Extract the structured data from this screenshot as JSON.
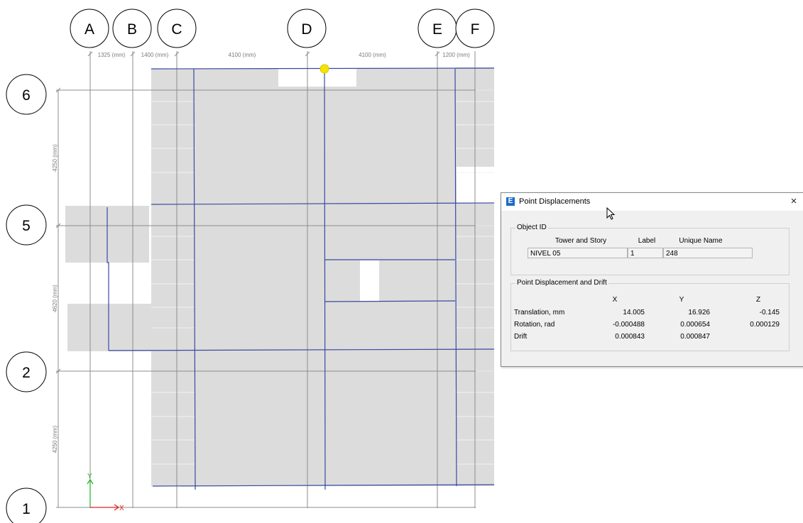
{
  "grid": {
    "columns": [
      "A",
      "B",
      "C",
      "D",
      "E",
      "F"
    ],
    "rows": [
      "6",
      "5",
      "2",
      "1"
    ],
    "column_dimensions": [
      "1325 (mm)",
      "1400 (mm)",
      "4100 (mm)",
      "4100 (mm)",
      "1200 (mm)"
    ],
    "row_dimensions": [
      "4250 (mm)",
      "4620 (mm)",
      "4250 (mm)"
    ]
  },
  "axes": {
    "x_label": "X",
    "y_label": "Y"
  },
  "colors": {
    "slab": "#dcdcdc",
    "frame_line": "#3a4aa0",
    "grid_line": "#8c8c8c",
    "selected_point": "#f5e400",
    "x_axis": "#e02020",
    "y_axis": "#20b020",
    "app_icon": "#1c6cc8"
  },
  "dialog": {
    "app_icon": "E",
    "title": "Point Displacements",
    "close_icon": "×",
    "object_id": {
      "legend": "Object ID",
      "headers": [
        "Tower and Story",
        "Label",
        "Unique Name"
      ],
      "values": [
        "NIVEL 05",
        "1",
        "248"
      ]
    },
    "displacement": {
      "legend": "Point Displacement and Drift",
      "headers": [
        "X",
        "Y",
        "Z"
      ],
      "rows": [
        {
          "label": "Translation, mm",
          "x": "14.005",
          "y": "16.926",
          "z": "-0.145"
        },
        {
          "label": "Rotation, rad",
          "x": "-0.000488",
          "y": "0.000654",
          "z": "0.000129"
        },
        {
          "label": "Drift",
          "x": "0.000843",
          "y": "0.000847",
          "z": ""
        }
      ]
    }
  }
}
